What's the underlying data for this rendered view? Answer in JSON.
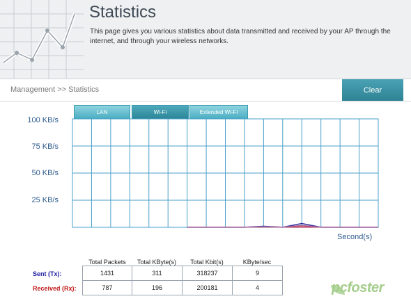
{
  "header": {
    "title": "Statistics",
    "description": "This page gives you various statistics about data transmitted and received by your AP through the internet, and through your wireless networks."
  },
  "breadcrumb": "Management >> Statistics",
  "clear_button": "Clear",
  "tabs": [
    {
      "label": "LAN",
      "active": false
    },
    {
      "label": "Wi-Fi",
      "active": true
    },
    {
      "label": "Extended Wi-Fi",
      "active": false
    }
  ],
  "chart_data": {
    "type": "line",
    "ylabels": [
      "100 KB/s",
      "75 KB/s",
      "50 KB/s",
      "25 KB/s"
    ],
    "ylim": [
      0,
      100
    ],
    "xlabel": "Second(s)",
    "grid": true,
    "x": [
      0,
      1,
      2,
      3,
      4,
      5,
      6,
      7,
      8,
      9,
      10,
      11,
      12,
      13,
      14,
      15,
      16
    ],
    "series": [
      {
        "color": "#d0103a",
        "values": [
          null,
          null,
          null,
          null,
          null,
          null,
          0.2,
          0.2,
          0.2,
          0.2,
          0.3,
          0.2,
          0.4,
          0.2,
          0.2,
          0.2,
          0.2
        ]
      },
      {
        "color": "#3030a0",
        "values": [
          null,
          null,
          null,
          null,
          null,
          null,
          0.1,
          0.1,
          0.1,
          0.1,
          1.0,
          0.1,
          3.5,
          0.1,
          0.1,
          0.1,
          0.1
        ]
      },
      {
        "color": "#a86a9a",
        "values": [
          null,
          null,
          null,
          null,
          null,
          null,
          0.1,
          0.1,
          0.1,
          0.1,
          0.5,
          0.1,
          1.8,
          0.1,
          0.1,
          0.1,
          0.1
        ]
      }
    ]
  },
  "stats": {
    "columns": [
      "Total Packets",
      "Total KByte(s)",
      "Total Kbit(s)",
      "KByte/sec"
    ],
    "rows": [
      {
        "label": "Sent (Tx):",
        "values": [
          "1431",
          "311",
          "318237",
          "9"
        ]
      },
      {
        "label": "Received (Rx):",
        "values": [
          "787",
          "196",
          "200181",
          "4"
        ]
      }
    ]
  },
  "watermark": "pcfoster"
}
